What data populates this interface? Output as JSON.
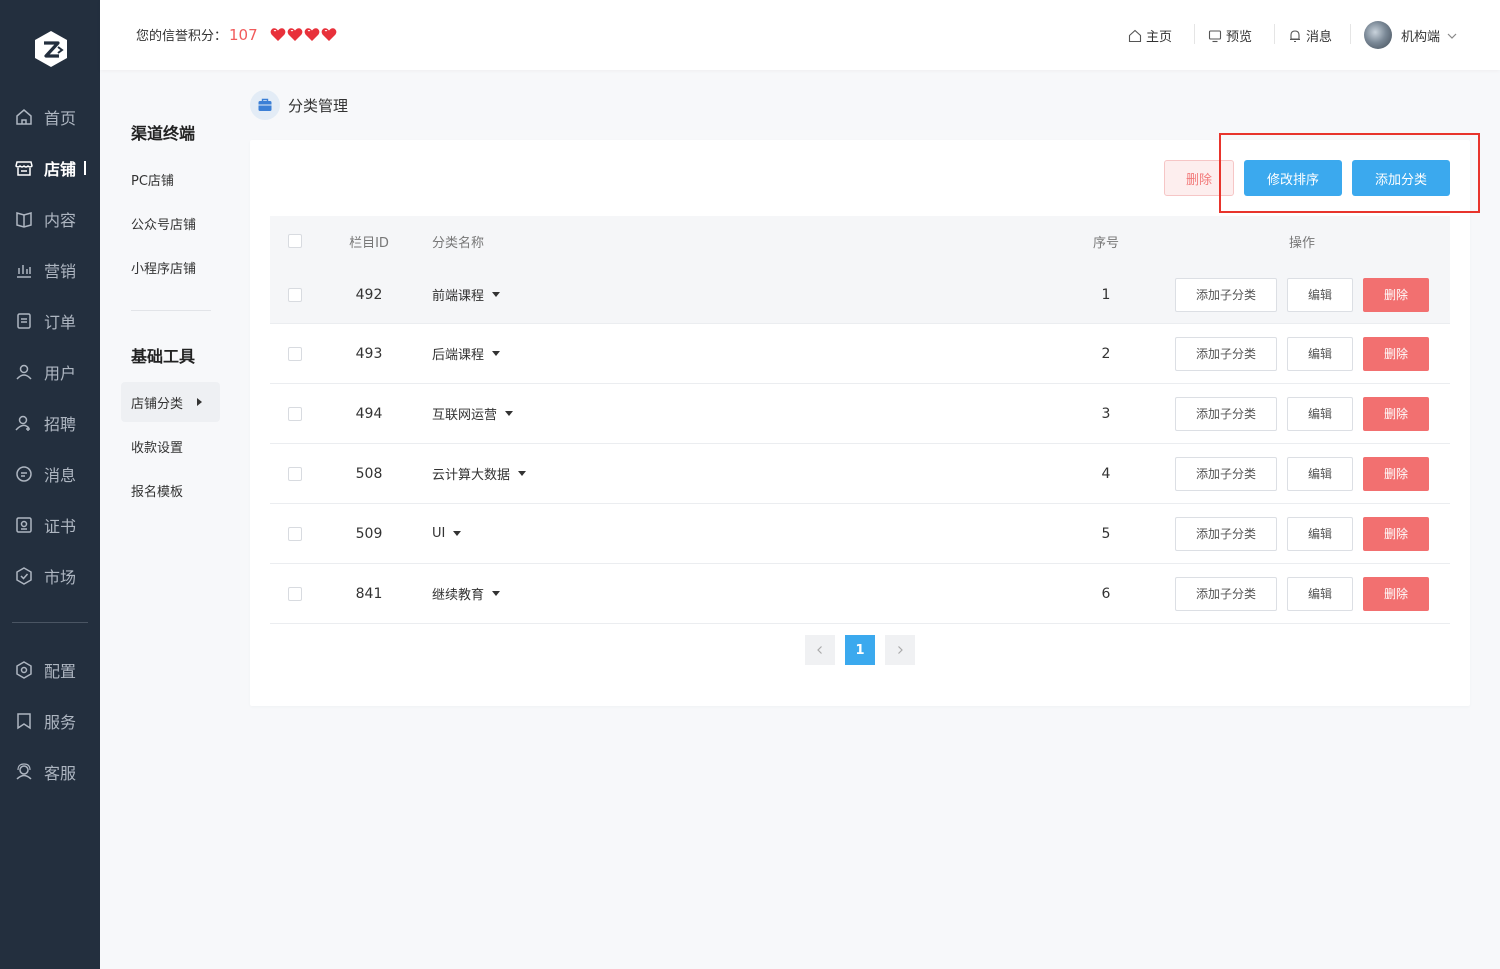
{
  "sidebar": {
    "logo_letter": "Z",
    "items": [
      {
        "label": "首页",
        "icon": "home-icon"
      },
      {
        "label": "店铺",
        "icon": "store-icon",
        "active": true
      },
      {
        "label": "内容",
        "icon": "book-icon"
      },
      {
        "label": "营销",
        "icon": "bar-chart-icon"
      },
      {
        "label": "订单",
        "icon": "order-icon"
      },
      {
        "label": "用户",
        "icon": "user-icon"
      },
      {
        "label": "招聘",
        "icon": "recruit-icon"
      },
      {
        "label": "消息",
        "icon": "message-icon"
      },
      {
        "label": "证书",
        "icon": "certificate-icon"
      },
      {
        "label": "市场",
        "icon": "market-icon"
      },
      {
        "label": "配置",
        "icon": "settings-icon"
      },
      {
        "label": "服务",
        "icon": "bookmark-icon"
      },
      {
        "label": "客服",
        "icon": "headset-icon"
      }
    ]
  },
  "header": {
    "credit_label": "您的信誉积分：",
    "credit_score": "107",
    "hearts": 4,
    "links": [
      {
        "label": "主页",
        "icon": "home-icon"
      },
      {
        "label": "预览",
        "icon": "monitor-icon"
      },
      {
        "label": "消息",
        "icon": "bell-icon"
      }
    ],
    "user_name": "机构端"
  },
  "subnav": {
    "group1_title": "渠道终端",
    "group1_items": [
      "PC店铺",
      "公众号店铺",
      "小程序店铺"
    ],
    "group2_title": "基础工具",
    "group2_items": [
      "店铺分类",
      "收款设置",
      "报名模板"
    ],
    "active_item": "店铺分类"
  },
  "page": {
    "title": "分类管理",
    "btn_delete": "删除",
    "btn_sort": "修改排序",
    "btn_add": "添加分类"
  },
  "table": {
    "headers": {
      "id": "栏目ID",
      "name": "分类名称",
      "seq": "序号",
      "ops": "操作"
    },
    "op_add_child": "添加子分类",
    "op_edit": "编辑",
    "op_delete": "删除",
    "rows": [
      {
        "id": "492",
        "name": "前端课程",
        "seq": "1"
      },
      {
        "id": "493",
        "name": "后端课程",
        "seq": "2"
      },
      {
        "id": "494",
        "name": "互联网运营",
        "seq": "3"
      },
      {
        "id": "508",
        "name": "云计算大数据",
        "seq": "4"
      },
      {
        "id": "509",
        "name": "UI",
        "seq": "5"
      },
      {
        "id": "841",
        "name": "继续教育",
        "seq": "6"
      }
    ]
  },
  "pagination": {
    "current": "1"
  },
  "colors": {
    "primary": "#3ba9ee",
    "danger": "#f27070",
    "sidebar": "#232f3e",
    "highlight": "#e8342c"
  }
}
